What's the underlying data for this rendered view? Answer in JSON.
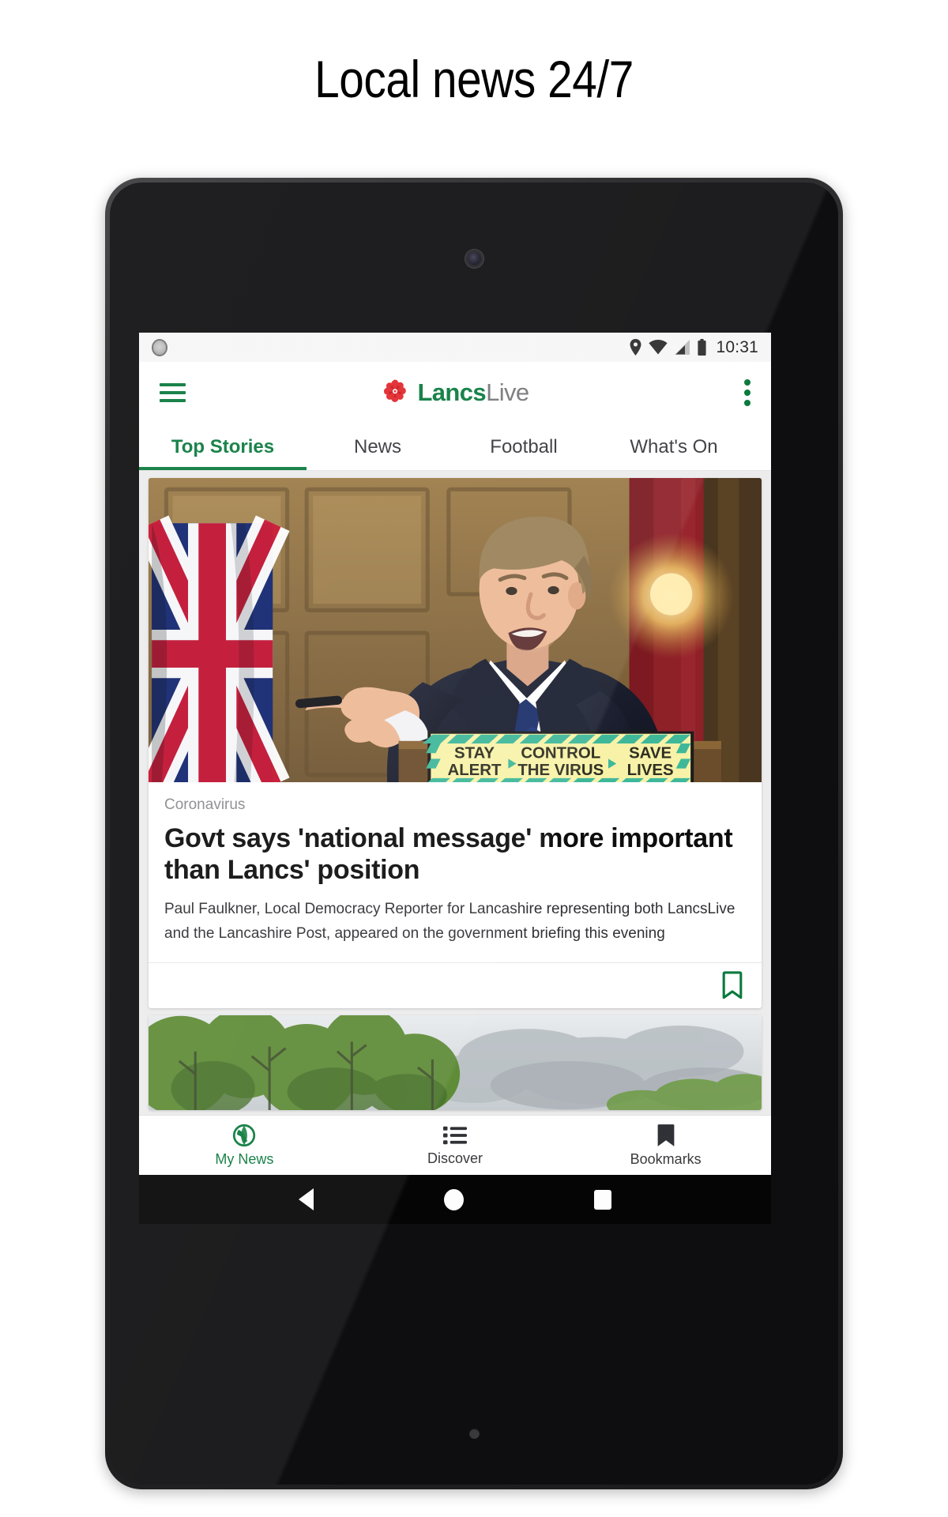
{
  "promo": {
    "title": "Local news 24/7"
  },
  "status_bar": {
    "left_icon": "circle-indicator-icon",
    "icons": [
      "location-pin-icon",
      "wifi-icon",
      "cell-signal-icon",
      "battery-icon"
    ],
    "time": "10:31"
  },
  "app_bar": {
    "menu_icon": "hamburger-menu-icon",
    "logo_icon": "lancashire-rose-icon",
    "brand_primary": "Lancs",
    "brand_secondary": "Live",
    "overflow_icon": "kebab-menu-icon"
  },
  "tabs": [
    {
      "label": "Top Stories",
      "active": true
    },
    {
      "label": "News",
      "active": false
    },
    {
      "label": "Football",
      "active": false
    },
    {
      "label": "What's On",
      "active": false
    }
  ],
  "feed": {
    "articles": [
      {
        "kicker": "Coronavirus",
        "headline": "Govt says 'national message' more important than Lancs' position",
        "standfirst": "Paul Faulkner, Local Democracy Reporter for Lancashire representing both LancsLive and the Lancashire Post, appeared on the government briefing this evening",
        "image_alt": "Government minister gesturing behind a lectern at a coronavirus press briefing, Union flag at left",
        "podium_sign": {
          "line1_a": "STAY",
          "line1_b": "ALERT",
          "line2_a": "CONTROL",
          "line2_b": "THE VIRUS",
          "line3_a": "SAVE",
          "line3_b": "LIVES"
        },
        "bookmark_icon": "bookmark-outline-icon"
      },
      {
        "image_alt": "Green leafy trees against an overcast grey cloudy sky"
      }
    ]
  },
  "bottom_nav": [
    {
      "label": "My News",
      "icon": "globe-icon",
      "active": true
    },
    {
      "label": "Discover",
      "icon": "list-icon",
      "active": false
    },
    {
      "label": "Bookmarks",
      "icon": "bookmark-filled-icon",
      "active": false
    }
  ],
  "system_nav": [
    {
      "name": "back-button",
      "icon": "triangle-back-icon"
    },
    {
      "name": "home-button",
      "icon": "circle-home-icon"
    },
    {
      "name": "recents-button",
      "icon": "square-recents-icon"
    }
  ],
  "colors": {
    "brand_green": "#0a7a3d",
    "rose_red": "#e2272c",
    "sign_yellow": "#f7f2a8",
    "sign_teal": "#3fb89a",
    "text_dark": "#0d0d0d"
  }
}
